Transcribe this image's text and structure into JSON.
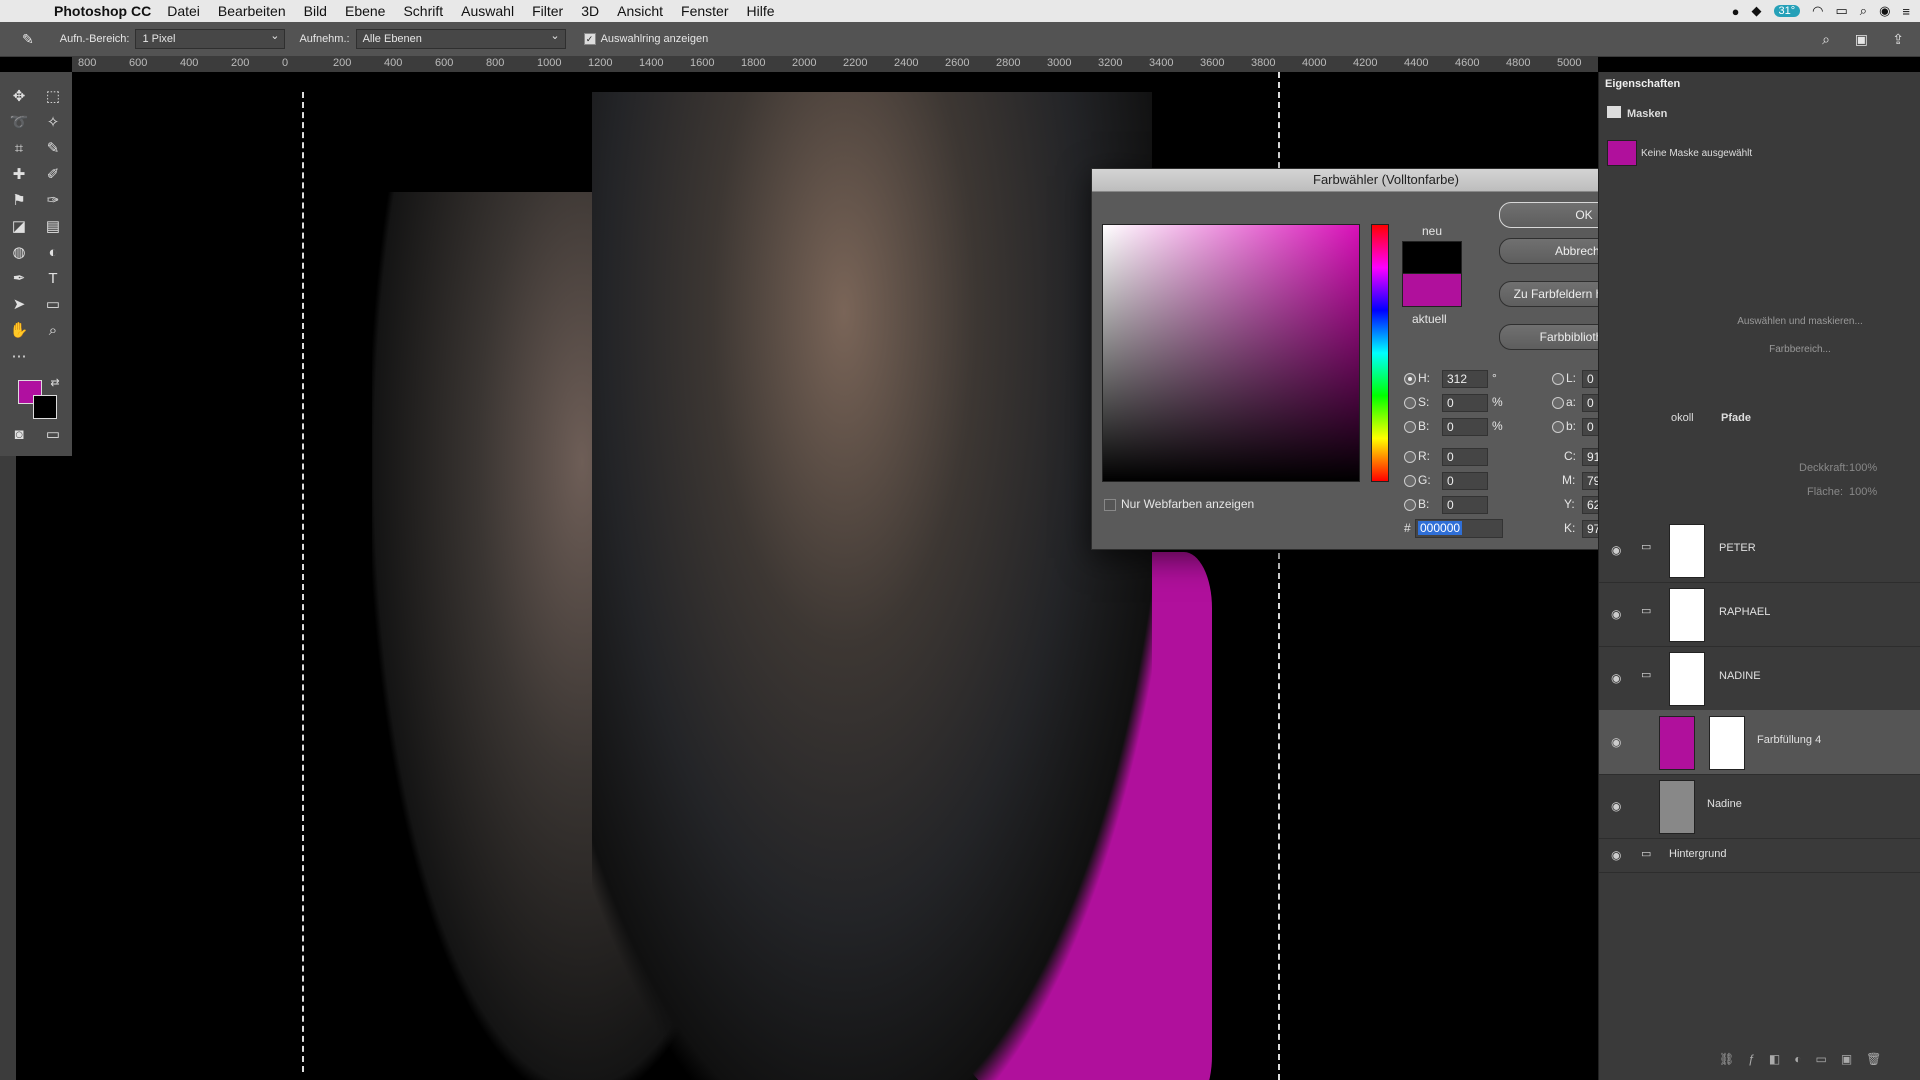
{
  "menubar": {
    "app": "Photoshop CC",
    "items": [
      "Datei",
      "Bearbeiten",
      "Bild",
      "Ebene",
      "Schrift",
      "Auswahl",
      "Filter",
      "3D",
      "Ansicht",
      "Fenster",
      "Hilfe"
    ],
    "battery_badge": "31°"
  },
  "options": {
    "sample_size_label": "Aufn.-Bereich:",
    "sample_size_value": "1 Pixel",
    "sample_label": "Aufnehm.:",
    "sample_value": "Alle Ebenen",
    "ring_label": "Auswahlring anzeigen"
  },
  "ruler_ticks": [
    "800",
    "600",
    "400",
    "200",
    "0",
    "200",
    "400",
    "600",
    "800",
    "1000",
    "1200",
    "1400",
    "1600",
    "1800",
    "2000",
    "2200",
    "2400",
    "2600",
    "2800",
    "3000",
    "3200",
    "3400",
    "3600",
    "3800",
    "4000",
    "4200",
    "4400",
    "4600",
    "4800",
    "5000"
  ],
  "dialog": {
    "title": "Farbwähler (Volltonfarbe)",
    "new_label": "neu",
    "current_label": "aktuell",
    "buttons": {
      "ok": "OK",
      "cancel": "Abbrechen",
      "add": "Zu Farbfeldern hinzufügen",
      "libraries": "Farbbibliotheken"
    },
    "web_only": "Nur Webfarben anzeigen",
    "hsb": {
      "h_label": "H:",
      "h": "312",
      "h_unit": "°",
      "s_label": "S:",
      "s": "0",
      "b_label": "B:",
      "b": "0",
      "pct": "%"
    },
    "rgb": {
      "r_label": "R:",
      "r": "0",
      "g_label": "G:",
      "g": "0",
      "b_label": "B:",
      "b": "0"
    },
    "lab": {
      "l_label": "L:",
      "l": "0",
      "a_label": "a:",
      "a": "0",
      "b_label": "b:",
      "b": "0"
    },
    "cmyk": {
      "c_label": "C:",
      "c": "91",
      "m_label": "M:",
      "m": "79",
      "y_label": "Y:",
      "y": "62",
      "k_label": "K:",
      "k": "97",
      "pct": "%"
    },
    "hex_label": "#",
    "hex": "000000",
    "colors": {
      "new": "#000000",
      "current": "#b0109c"
    }
  },
  "properties": {
    "title": "Eigenschaften",
    "section": "Masken",
    "mask_status": "Keine Maske ausgewählt",
    "select_mask": "Auswählen und maskieren...",
    "color_range": "Farbbereich..."
  },
  "layers_panel": {
    "tabs": [
      "okoll",
      "Pfade"
    ],
    "opacity_label": "Deckkraft:",
    "opacity": "100%",
    "fill_label": "Fläche:",
    "fill": "100%",
    "layers": [
      {
        "name": "PETER"
      },
      {
        "name": "RAPHAEL"
      },
      {
        "name": "NADINE"
      },
      {
        "name": "Farbfüllung 4"
      },
      {
        "name": "Nadine"
      },
      {
        "name": "Hintergrund"
      }
    ]
  }
}
